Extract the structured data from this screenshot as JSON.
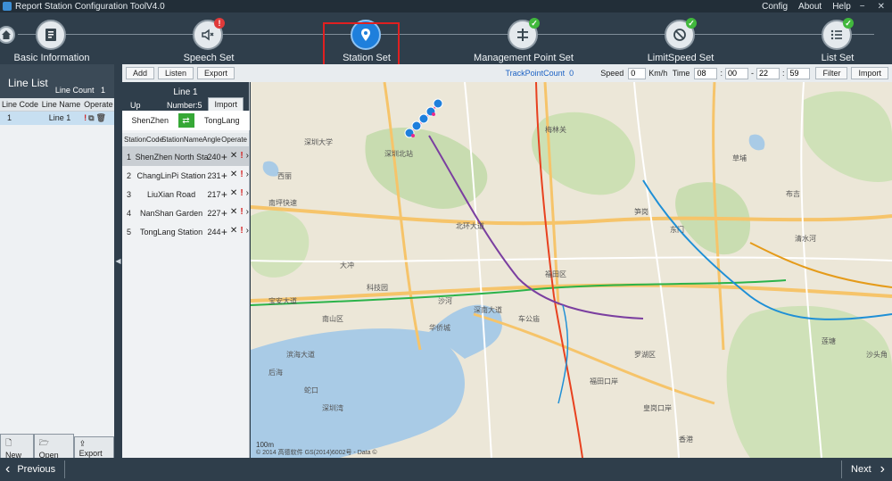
{
  "app": {
    "title": "Report Station Configuration ToolV4.0"
  },
  "menu": {
    "config": "Config",
    "about": "About",
    "help": "Help"
  },
  "steps": [
    {
      "label": "Basic Information",
      "icon": "document-icon",
      "status": ""
    },
    {
      "label": "Speech Set",
      "icon": "speaker-icon",
      "status": "warn"
    },
    {
      "label": "Station Set",
      "icon": "location-pin-icon",
      "status": "active"
    },
    {
      "label": "Management Point Set",
      "icon": "management-icon",
      "status": "ok"
    },
    {
      "label": "LimitSpeed Set",
      "icon": "no-entry-icon",
      "status": "ok"
    },
    {
      "label": "List Set",
      "icon": "list-icon",
      "status": "ok"
    }
  ],
  "line_list": {
    "title": "Line List",
    "count_label": "Line Count",
    "count": "1",
    "columns": [
      "Line Code",
      "Line Name",
      "Operate"
    ],
    "rows": [
      {
        "code": "1",
        "name": "Line 1"
      }
    ],
    "buttons": {
      "new": "New",
      "open": "Open",
      "export": "Export"
    }
  },
  "toolbar": {
    "add": "Add",
    "listen": "Listen",
    "export": "Export",
    "track_label": "TrackPointCount",
    "track_count": "0",
    "speed_label": "Speed",
    "speed_value": "0",
    "speed_unit": "Km/h",
    "time_label": "Time",
    "time_h1": "08",
    "time_m1": "00",
    "time_h2": "22",
    "time_m2": "59",
    "filter": "Filter",
    "import": "Import"
  },
  "station_panel": {
    "line_name": "Line 1",
    "direction": "Up",
    "number_label": "Number:5",
    "import": "Import",
    "from": "ShenZhen",
    "to": "TongLang",
    "columns": [
      "StationCode",
      "StationName",
      "Angle",
      "Operate"
    ],
    "stations": [
      {
        "idx": "1",
        "name": "ShenZhen North Stati",
        "angle": "240"
      },
      {
        "idx": "2",
        "name": "ChangLinPi Station",
        "angle": "231"
      },
      {
        "idx": "3",
        "name": "LiuXian Road",
        "angle": "217"
      },
      {
        "idx": "4",
        "name": "NanShan Garden",
        "angle": "227"
      },
      {
        "idx": "5",
        "name": "TongLang Station",
        "angle": "244"
      }
    ]
  },
  "map": {
    "labels": [
      "南坪快速",
      "宝安大道",
      "深圳大学",
      "北环大道",
      "深南大道",
      "滨海大道",
      "福田区",
      "罗湖区",
      "南山区",
      "深圳湾",
      "香港",
      "梅林关",
      "东门",
      "西丽",
      "蛇口",
      "后海",
      "华侨城",
      "车公庙",
      "科技园",
      "深圳北站",
      "布吉",
      "草埔",
      "笋岗",
      "清水河",
      "莲塘",
      "沙头角",
      "福田口岸",
      "皇岗口岸",
      "沙河",
      "大冲"
    ],
    "scale": "100m",
    "credit": "© 2014 高德软件 GS(2014)6002号 - Data ©"
  },
  "footer": {
    "previous": "Previous",
    "next": "Next"
  },
  "colors": {
    "accent": "#1e7fdc",
    "ok": "#41b83d",
    "warn": "#e03a3a",
    "dark": "#2f3e4b"
  }
}
